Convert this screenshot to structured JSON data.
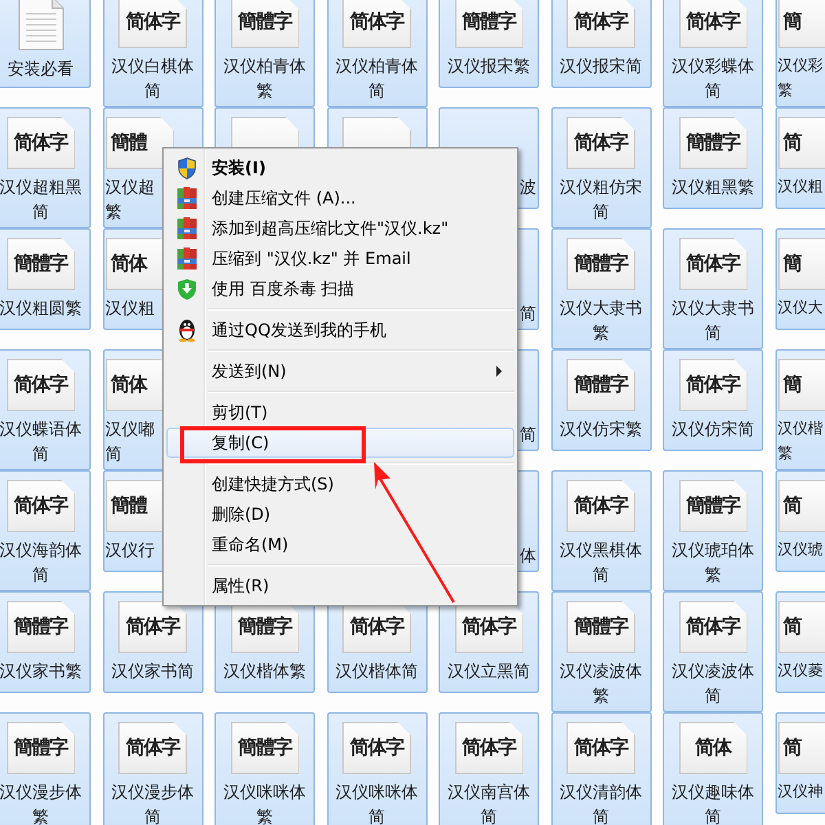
{
  "files": {
    "rows": [
      [
        {
          "kind": "doc",
          "lines": [
            "安装必看"
          ]
        },
        {
          "kind": "font",
          "preview": "简体字",
          "lines": [
            "汉仪白棋体",
            "简"
          ]
        },
        {
          "kind": "font",
          "preview": "簡體字",
          "lines": [
            "汉仪柏青体",
            "繁"
          ]
        },
        {
          "kind": "font",
          "preview": "简体字",
          "lines": [
            "汉仪柏青体",
            "简"
          ]
        },
        {
          "kind": "font",
          "preview": "簡體字",
          "lines": [
            "汉仪报宋繁"
          ]
        },
        {
          "kind": "font",
          "preview": "简体字",
          "lines": [
            "汉仪报宋简"
          ]
        },
        {
          "kind": "font",
          "preview": "简体字",
          "lines": [
            "汉仪彩蝶体",
            "简"
          ]
        },
        {
          "kind": "font",
          "preview": "簡",
          "lines": [
            "汉仪彩",
            "繁"
          ]
        }
      ],
      [
        {
          "kind": "font",
          "preview": "简体字",
          "lines": [
            "汉仪超粗黑",
            "简"
          ]
        },
        {
          "kind": "font",
          "preview": "簡體",
          "lines": [
            "汉仪超",
            "繁"
          ]
        },
        {
          "kind": "covered"
        },
        {
          "kind": "covered"
        },
        {
          "kind": "covered",
          "lines": [
            "波"
          ]
        },
        {
          "kind": "font",
          "preview": "简体字",
          "lines": [
            "汉仪粗仿宋",
            "简"
          ]
        },
        {
          "kind": "font",
          "preview": "簡體字",
          "lines": [
            "汉仪粗黑繁"
          ]
        },
        {
          "kind": "font",
          "preview": "简",
          "lines": [
            "汉仪粗"
          ]
        }
      ],
      [
        {
          "kind": "font",
          "preview": "簡體字",
          "lines": [
            "汉仪粗圆繁"
          ]
        },
        {
          "kind": "font",
          "preview": "简体",
          "lines": [
            "汉仪粗"
          ]
        },
        {
          "kind": "covered"
        },
        {
          "kind": "covered"
        },
        {
          "kind": "covered",
          "lines": [
            "简"
          ]
        },
        {
          "kind": "font",
          "preview": "簡體字",
          "lines": [
            "汉仪大隶书",
            "繁"
          ]
        },
        {
          "kind": "font",
          "preview": "简体字",
          "lines": [
            "汉仪大隶书",
            "简"
          ]
        },
        {
          "kind": "font",
          "preview": "簡",
          "lines": [
            "汉仪大"
          ]
        }
      ],
      [
        {
          "kind": "font",
          "preview": "简体字",
          "lines": [
            "汉仪蝶语体",
            "简"
          ]
        },
        {
          "kind": "font",
          "preview": "简体",
          "lines": [
            "汉仪嘟",
            "简"
          ]
        },
        {
          "kind": "covered"
        },
        {
          "kind": "covered"
        },
        {
          "kind": "covered",
          "lines": [
            "简"
          ]
        },
        {
          "kind": "font",
          "preview": "簡體字",
          "lines": [
            "汉仪仿宋繁"
          ]
        },
        {
          "kind": "font",
          "preview": "简体字",
          "lines": [
            "汉仪仿宋简"
          ]
        },
        {
          "kind": "font",
          "preview": "簡",
          "lines": [
            "汉仪楷",
            "繁"
          ]
        }
      ],
      [
        {
          "kind": "font",
          "preview": "简体字",
          "lines": [
            "汉仪海韵体",
            "简"
          ]
        },
        {
          "kind": "font",
          "preview": "簡體",
          "lines": [
            "汉仪行"
          ]
        },
        {
          "kind": "covered"
        },
        {
          "kind": "covered"
        },
        {
          "kind": "covered",
          "lines": [
            "体"
          ]
        },
        {
          "kind": "font",
          "preview": "简体字",
          "lines": [
            "汉仪黑棋体",
            "简"
          ]
        },
        {
          "kind": "font",
          "preview": "簡體字",
          "lines": [
            "汉仪琥珀体",
            "繁"
          ]
        },
        {
          "kind": "font",
          "preview": "简",
          "lines": [
            "汉仪琥"
          ]
        }
      ],
      [
        {
          "kind": "font",
          "preview": "簡體字",
          "lines": [
            "汉仪家书繁"
          ]
        },
        {
          "kind": "font",
          "preview": "简体字",
          "lines": [
            "汉仪家书简"
          ]
        },
        {
          "kind": "font",
          "preview": "簡體字",
          "lines": [
            "汉仪楷体繁"
          ]
        },
        {
          "kind": "font",
          "preview": "简体字",
          "lines": [
            "汉仪楷体简"
          ]
        },
        {
          "kind": "font",
          "preview": "简体字",
          "lines": [
            "汉仪立黑简"
          ]
        },
        {
          "kind": "font",
          "preview": "簡體字",
          "lines": [
            "汉仪凌波体",
            "繁"
          ]
        },
        {
          "kind": "font",
          "preview": "简体字",
          "lines": [
            "汉仪凌波体",
            "简"
          ]
        },
        {
          "kind": "font",
          "preview": "简",
          "lines": [
            "汉仪菱"
          ]
        }
      ],
      [
        {
          "kind": "font",
          "preview": "簡體字",
          "lines": [
            "汉仪漫步体",
            "繁"
          ]
        },
        {
          "kind": "font",
          "preview": "简体字",
          "lines": [
            "汉仪漫步体",
            "简"
          ]
        },
        {
          "kind": "font",
          "preview": "簡體字",
          "lines": [
            "汉仪咪咪体",
            "繁"
          ]
        },
        {
          "kind": "font",
          "preview": "简体字",
          "lines": [
            "汉仪咪咪体",
            "简"
          ]
        },
        {
          "kind": "font",
          "preview": "简体字",
          "lines": [
            "汉仪南宫体",
            "简"
          ]
        },
        {
          "kind": "font",
          "preview": "简体字",
          "lines": [
            "汉仪清韵体",
            "简"
          ]
        },
        {
          "kind": "font",
          "preview": "简体",
          "lines": [
            "汉仪趣味体",
            "简"
          ]
        },
        {
          "kind": "font",
          "preview": "简",
          "lines": [
            "汉仪神"
          ]
        }
      ]
    ]
  },
  "context_menu": {
    "items": [
      {
        "kind": "item",
        "label": "安装(I)",
        "default": true,
        "submenu": false,
        "selected": false
      },
      {
        "kind": "item",
        "label": "创建压缩文件 (A)...",
        "default": false,
        "submenu": false,
        "selected": false
      },
      {
        "kind": "item",
        "label": "添加到超高压缩比文件\"汉仪.kz\"",
        "default": false,
        "submenu": false,
        "selected": false
      },
      {
        "kind": "item",
        "label": "压缩到 \"汉仪.kz\" 并 Email",
        "default": false,
        "submenu": false,
        "selected": false
      },
      {
        "kind": "item",
        "label": "使用 百度杀毒 扫描",
        "default": false,
        "submenu": false,
        "selected": false
      },
      {
        "kind": "separator"
      },
      {
        "kind": "item",
        "label": "通过QQ发送到我的手机",
        "default": false,
        "submenu": false,
        "selected": false
      },
      {
        "kind": "separator"
      },
      {
        "kind": "item",
        "label": "发送到(N)",
        "default": false,
        "submenu": true,
        "selected": false
      },
      {
        "kind": "separator"
      },
      {
        "kind": "item",
        "label": "剪切(T)",
        "default": false,
        "submenu": false,
        "selected": false
      },
      {
        "kind": "item",
        "label": "复制(C)",
        "default": false,
        "submenu": false,
        "selected": true
      },
      {
        "kind": "separator"
      },
      {
        "kind": "item",
        "label": "创建快捷方式(S)",
        "default": false,
        "submenu": false,
        "selected": false
      },
      {
        "kind": "item",
        "label": "删除(D)",
        "default": false,
        "submenu": false,
        "selected": false
      },
      {
        "kind": "item",
        "label": "重命名(M)",
        "default": false,
        "submenu": false,
        "selected": false
      },
      {
        "kind": "separator"
      },
      {
        "kind": "item",
        "label": "属性(R)",
        "default": false,
        "submenu": false,
        "selected": false
      }
    ]
  }
}
